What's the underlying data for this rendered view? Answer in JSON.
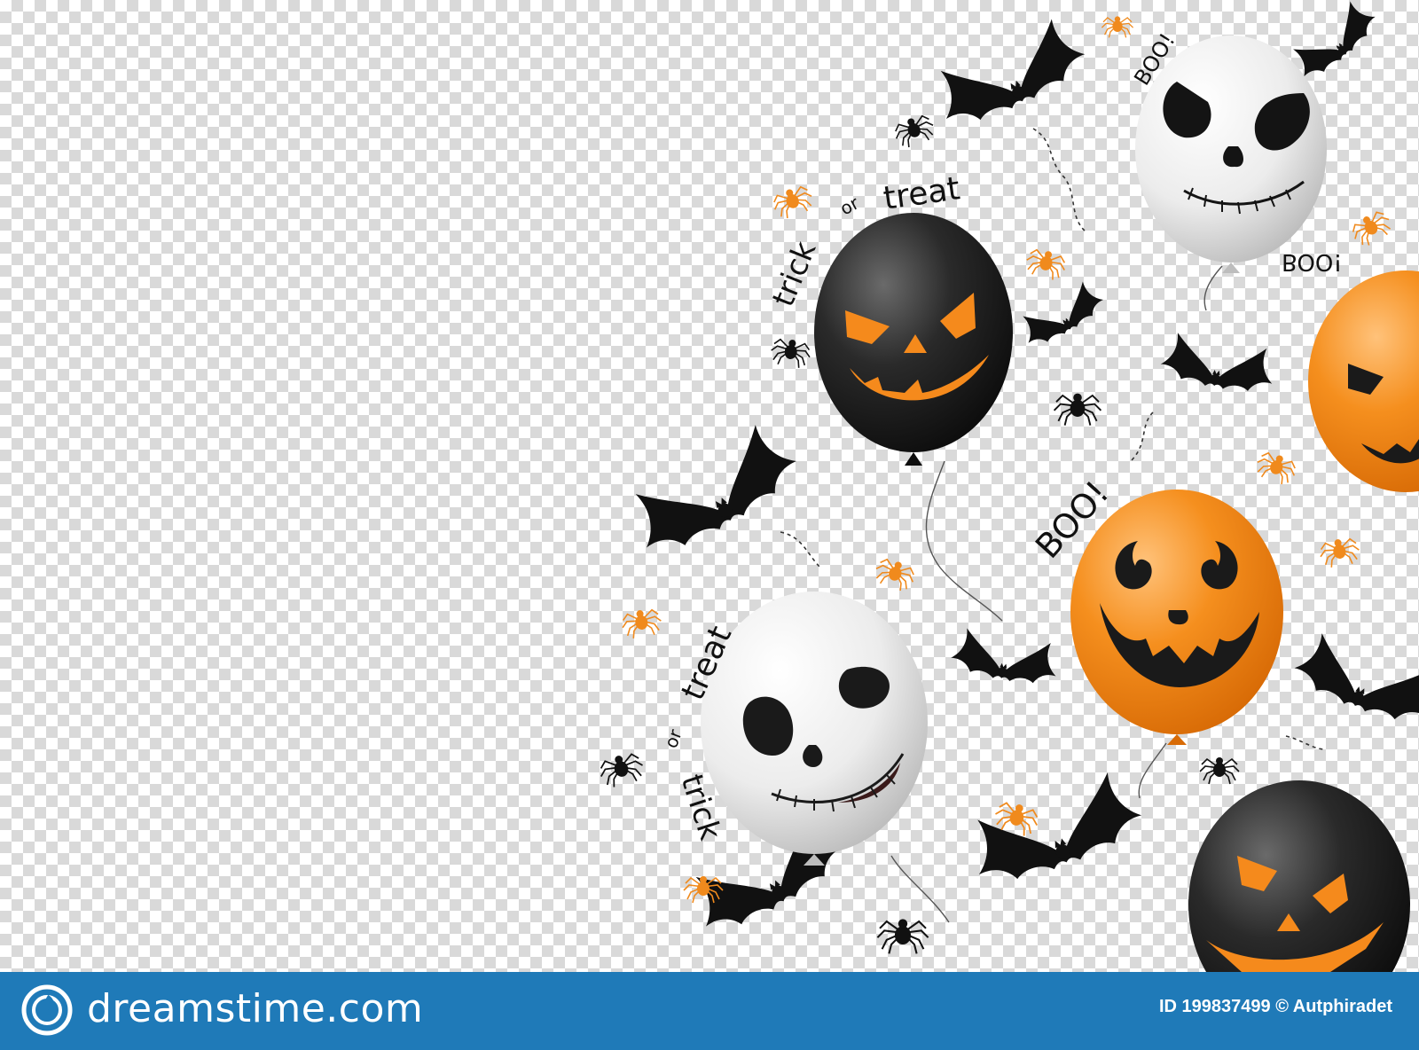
{
  "texts": {
    "trick_1": "trick",
    "or_1": "or",
    "treat_1": "treat",
    "trick_2": "trick",
    "or_2": "or",
    "treat_2": "treat",
    "boo_1": "BOO!",
    "boo_2": "BOO!",
    "boo_3": "BOO!"
  },
  "footer": {
    "brand": "dreamstime.com",
    "id_text": "ID 199837499 © Autphiradet"
  },
  "colors": {
    "orange": "#f08a1d",
    "black_balloon": "#1a1a1a",
    "white_balloon": "#f2f2f2",
    "footer_blue": "#1f7ab8"
  }
}
